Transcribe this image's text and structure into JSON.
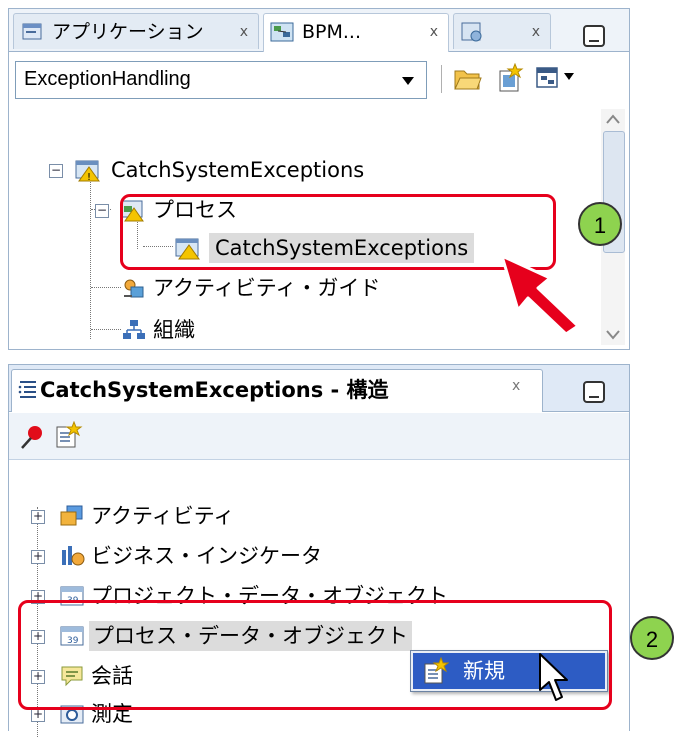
{
  "top_panel": {
    "tabs": [
      {
        "label": "アプリケーション",
        "icon": "application-navigator-icon",
        "close": "x"
      },
      {
        "label": "BPM...",
        "icon": "bpm-project-icon",
        "close": "x"
      },
      {
        "label": "",
        "icon": "resource-palette-icon",
        "close": "x"
      }
    ],
    "project_select": {
      "value": "ExceptionHandling"
    },
    "tree": {
      "root": "CatchSystemExceptions",
      "process_folder": "プロセス",
      "process_item": "CatchSystemExceptions",
      "activity_guide": "アクティビティ・ガイド",
      "organization": "組織"
    }
  },
  "structure_panel": {
    "title": "CatchSystemExceptions - 構造",
    "close": "x",
    "items": [
      {
        "label": "アクティビティ"
      },
      {
        "label": "ビジネス・インジケータ"
      },
      {
        "label": "プロジェクト・データ・オブジェクト"
      },
      {
        "label": "プロセス・データ・オブジェクト"
      },
      {
        "label": "会話"
      },
      {
        "label": "測定"
      }
    ],
    "context_menu": {
      "new_label": "新規"
    }
  },
  "callouts": {
    "step1": "1",
    "step2": "2"
  },
  "colors": {
    "highlight": "#e6001c",
    "badge": "#8ed34f",
    "menu": "#2d5cc4"
  }
}
